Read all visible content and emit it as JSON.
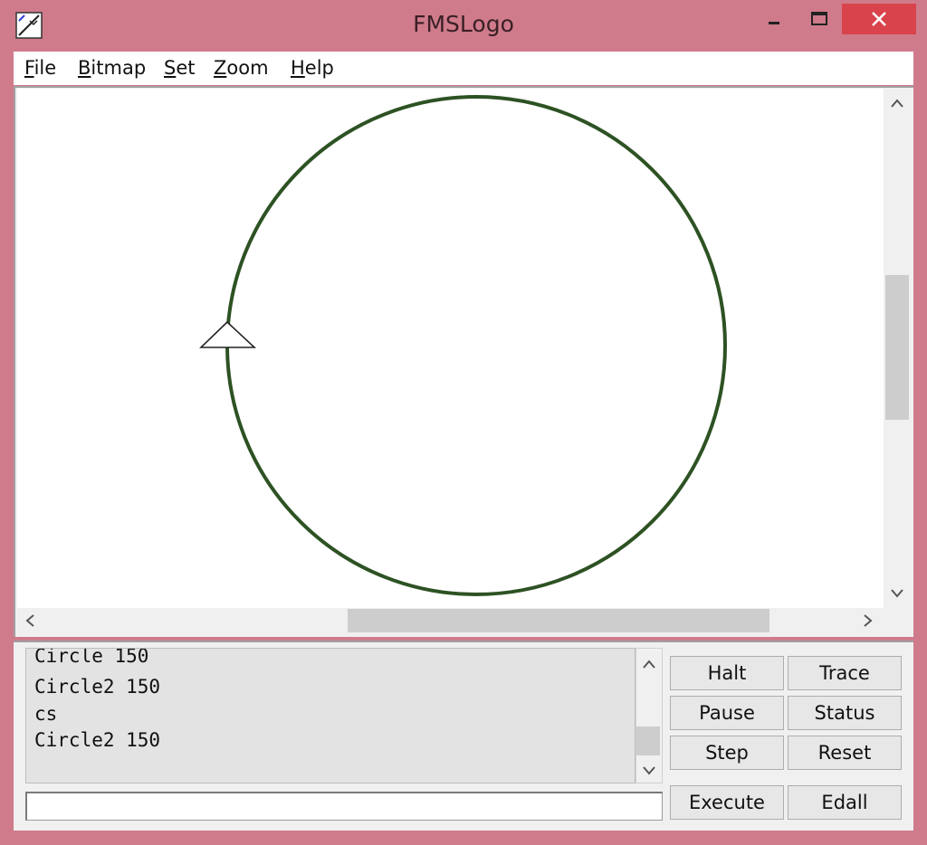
{
  "window": {
    "title": "FMSLogo",
    "controls": {
      "minimize_icon": "minimize-icon",
      "maximize_icon": "maximize-icon",
      "close_icon": "close-icon"
    }
  },
  "menu": {
    "items": [
      {
        "key": "F",
        "rest": "ile"
      },
      {
        "key": "B",
        "rest": "itmap"
      },
      {
        "key": "S",
        "rest": "et"
      },
      {
        "key": "Z",
        "rest": "oom"
      },
      {
        "key": "H",
        "rest": "elp"
      }
    ]
  },
  "canvas": {
    "shape": "circle",
    "stroke_color": "#2d5223",
    "turtle": "triangle-turtle-icon"
  },
  "commander": {
    "history": [
      "Circle 150",
      "Circle2 150",
      "cs",
      "Circle2 150"
    ],
    "input_value": "",
    "buttons": {
      "halt": "Halt",
      "trace": "Trace",
      "pause": "Pause",
      "status": "Status",
      "step": "Step",
      "reset": "Reset",
      "execute": "Execute",
      "edall": "Edall"
    }
  },
  "colors": {
    "frame": "#cf7b8b",
    "close_button": "#d9434b",
    "turtle_line": "#2d5223"
  }
}
